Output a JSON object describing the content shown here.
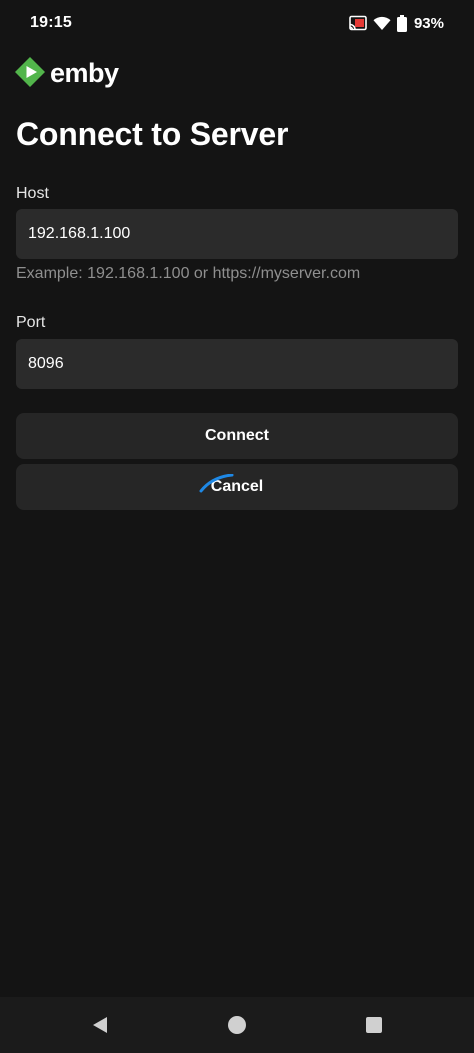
{
  "status_bar": {
    "time": "19:15",
    "battery_percent": "93%",
    "icons": [
      "cast-icon",
      "wifi-icon",
      "battery-icon"
    ]
  },
  "app": {
    "logo_text": "emby",
    "logo_color": "#52b54b"
  },
  "page": {
    "title": "Connect to Server"
  },
  "form": {
    "host": {
      "label": "Host",
      "value": "192.168.1.100",
      "hint": "Example: 192.168.1.100 or https://myserver.com"
    },
    "port": {
      "label": "Port",
      "value": "8096"
    }
  },
  "actions": {
    "connect_label": "Connect",
    "cancel_label": "Cancel",
    "spinner_color": "#1e88e5"
  },
  "nav_bar": {
    "icons": [
      "back-icon",
      "home-icon",
      "recents-icon"
    ]
  }
}
